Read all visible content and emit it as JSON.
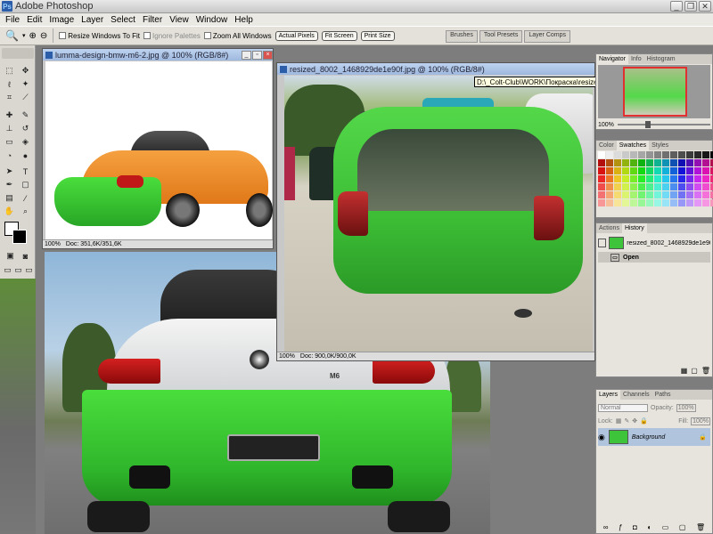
{
  "app": {
    "title": "Adobe Photoshop",
    "icon_label": "Ps"
  },
  "window_controls": {
    "minimize": "_",
    "restore": "❐",
    "close": "✕"
  },
  "menu": [
    "File",
    "Edit",
    "Image",
    "Layer",
    "Select",
    "Filter",
    "View",
    "Window",
    "Help"
  ],
  "options": {
    "resize_windows": "Resize Windows To Fit",
    "ignore_palettes": "Ignore Palettes",
    "zoom_all": "Zoom All Windows",
    "actual_pixels": "Actual Pixels",
    "fit_screen": "Fit Screen",
    "print_size": "Print Size"
  },
  "palette_well": [
    "Brushes",
    "Tool Presets",
    "Layer Comps"
  ],
  "doc1": {
    "title": "lumma-design-bmw-m6-2.jpg @ 100% (RGB/8#)",
    "zoom": "100%",
    "doc": "Doc: 351,6K/351,6K"
  },
  "doc2": {
    "title": "resized_8002_1468929de1e90f.jpg @ 100% (RGB/8#)",
    "zoom": "100%",
    "doc": "Doc: 900,0K/900,0K"
  },
  "tooltip": "D:\\_Colt-Club\\WORK\\Покраска\\resized_8002_1468929de1e90f.jpg @ 100% (RGB/8#)",
  "navigator": {
    "tabs": [
      "Navigator",
      "Info",
      "Histogram"
    ],
    "zoom": "100%"
  },
  "color": {
    "tabs": [
      "Color",
      "Swatches",
      "Styles"
    ]
  },
  "history": {
    "tabs": [
      "Actions",
      "History"
    ],
    "snapshot": "resized_8002_1468929de1e90f.jpg",
    "step": "Open"
  },
  "layers": {
    "tabs": [
      "Layers",
      "Channels",
      "Paths"
    ],
    "blend": "Normal",
    "opacity_label": "Opacity:",
    "opacity": "100%",
    "lock_label": "Lock:",
    "fill_label": "Fill:",
    "fill": "100%",
    "layer_name": "Background"
  },
  "colors": {
    "accent": "#2b5da8",
    "green": "#3ec43a",
    "orange": "#f08a2a"
  }
}
